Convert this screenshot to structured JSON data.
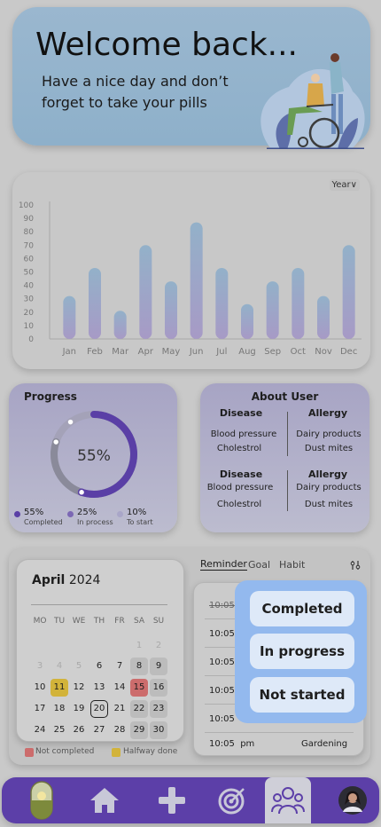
{
  "welcome": {
    "title": "Welcome back...",
    "subtitle": "Have a nice day and don’t forget to take your pills"
  },
  "chart": {
    "period_select": "Year"
  },
  "chart_data": {
    "type": "bar",
    "categories": [
      "Jan",
      "Feb",
      "Mar",
      "Apr",
      "May",
      "Jun",
      "Jul",
      "Aug",
      "Sep",
      "Oct",
      "Nov",
      "Dec"
    ],
    "values": [
      32,
      53,
      21,
      70,
      43,
      87,
      53,
      26,
      43,
      53,
      32,
      70
    ],
    "yticks": [
      0,
      10,
      20,
      30,
      40,
      50,
      60,
      70,
      80,
      90,
      100
    ],
    "ylim": [
      0,
      100
    ],
    "title": "",
    "xlabel": "",
    "ylabel": "",
    "bar_color": "#97a9c8",
    "grid": false
  },
  "progress": {
    "title": "Progress",
    "center_value": "55%",
    "fraction_completed": 0.55,
    "fraction_in_process": 0.25,
    "fraction_to_start": 0.1,
    "legend": [
      {
        "value": "55%",
        "label": "Completed",
        "color": "#5a3fa6"
      },
      {
        "value": "25%",
        "label": "In process",
        "color": "#7b67b4"
      },
      {
        "value": "10%",
        "label": "To start",
        "color": "#a9a6c8"
      }
    ]
  },
  "about": {
    "title": "About User",
    "disease_label": "Disease",
    "allergy_label": "Allergy",
    "diseases_1": [
      "Blood pressure",
      "Cholestrol"
    ],
    "allergies_1": [
      "Dairy products",
      "Dust mites"
    ],
    "diseases_2": [
      "Blood pressure",
      "Cholestrol"
    ],
    "allergies_2": [
      "Dairy products",
      "Dust mites"
    ]
  },
  "calendar": {
    "month": "April",
    "year": "2024",
    "weekdays": [
      "MO",
      "TU",
      "WE",
      "TH",
      "FR",
      "SA",
      "SU"
    ],
    "weeks": [
      [
        "",
        "",
        "",
        "",
        "",
        "1",
        "2"
      ],
      [
        "3",
        "4",
        "5",
        "6",
        "7",
        "8",
        "9"
      ],
      [
        "10",
        "11",
        "12",
        "13",
        "14",
        "15",
        "16"
      ],
      [
        "17",
        "18",
        "19",
        "20",
        "21",
        "22",
        "23"
      ],
      [
        "24",
        "25",
        "26",
        "27",
        "28",
        "29",
        "30"
      ]
    ],
    "legend_not_completed": "Not completed",
    "legend_halfway": "Halfway done",
    "color_not_completed": "#cc6c6c",
    "color_halfway": "#d2b33a"
  },
  "reminder": {
    "tabs": [
      "Reminder",
      "Goal",
      "Habit"
    ],
    "active_tab": "Reminder",
    "times": [
      "10:05",
      "10:05",
      "10:05",
      "10:05",
      "10:05",
      "10:05"
    ],
    "last_time": "10:05",
    "last_ampm": "pm",
    "last_activity": "Gardening"
  },
  "status_popup": {
    "options": [
      "Completed",
      "In progress",
      "Not started"
    ]
  },
  "nav": {
    "items": [
      "medicine",
      "home",
      "add",
      "goals",
      "community",
      "profile"
    ]
  }
}
